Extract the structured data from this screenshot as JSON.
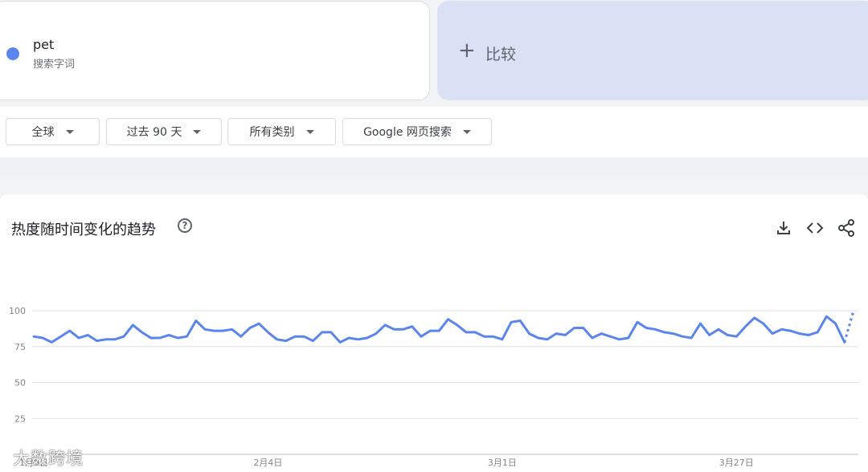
{
  "search_term": {
    "name": "pet",
    "subtitle": "搜索字词",
    "color": "#5a85ec"
  },
  "compare": {
    "plus": "+",
    "label": "比较"
  },
  "filters": [
    {
      "label": "全球"
    },
    {
      "label": "过去 90 天"
    },
    {
      "label": "所有类别"
    },
    {
      "label": "Google 网页搜索"
    }
  ],
  "chart_section": {
    "title": "热度随时间变化的趋势",
    "help": "?",
    "tools": [
      "download-icon",
      "embed-icon",
      "share-icon"
    ]
  },
  "watermark": "大数跨境",
  "chart_data": {
    "type": "line",
    "title": "",
    "xlabel": "",
    "ylabel": "",
    "ylim": [
      0,
      100
    ],
    "yticks": [
      25,
      50,
      75,
      100
    ],
    "xtick_labels": [
      "1月9日",
      "2月4日",
      "3月1日",
      "3月27日"
    ],
    "grid": true,
    "color": "#5a85ec",
    "series": [
      {
        "values": [
          82,
          81,
          78,
          82,
          86,
          81,
          83,
          79,
          80,
          80,
          82,
          90,
          85,
          81,
          81,
          83,
          81,
          82,
          93,
          87,
          86,
          86,
          87,
          82,
          88,
          91,
          85,
          80,
          79,
          82,
          82,
          79,
          85,
          85,
          78,
          81,
          80,
          81,
          84,
          90,
          87,
          87,
          89,
          82,
          86,
          86,
          94,
          90,
          85,
          85,
          82,
          82,
          80,
          92,
          93,
          84,
          81,
          80,
          84,
          83,
          88,
          88,
          81,
          84,
          82,
          80,
          81,
          92,
          88,
          87,
          85,
          84,
          82,
          81,
          91,
          83,
          87,
          83,
          82,
          89,
          95,
          91,
          84,
          87,
          86,
          84,
          83,
          85,
          96,
          91,
          78
        ],
        "partial_last": 100
      }
    ]
  }
}
